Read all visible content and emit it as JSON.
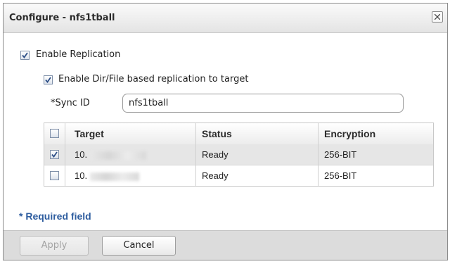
{
  "dialog": {
    "title": "Configure - nfs1tball"
  },
  "replication": {
    "enable_label": "Enable Replication",
    "enable_checked": true,
    "dirfile_label": "Enable Dir/File based replication to target",
    "dirfile_checked": true
  },
  "sync": {
    "label": "*Sync ID",
    "value": "nfs1tball"
  },
  "table": {
    "columns": [
      "Target",
      "Status",
      "Encryption"
    ],
    "rows": [
      {
        "checked": true,
        "target": "10.",
        "status": "Ready",
        "encryption": "256-BIT"
      },
      {
        "checked": false,
        "target": "10.",
        "status": "Ready",
        "encryption": "256-BIT"
      }
    ]
  },
  "footer_note": "* Required field",
  "buttons": {
    "apply": "Apply",
    "cancel": "Cancel"
  },
  "colors": {
    "accent": "#2e5d9f",
    "footer_bg": "#dcdcdc",
    "selected_row": "#e6e6e6"
  },
  "icons": {
    "close": "close-icon",
    "check": "checkmark-icon"
  }
}
